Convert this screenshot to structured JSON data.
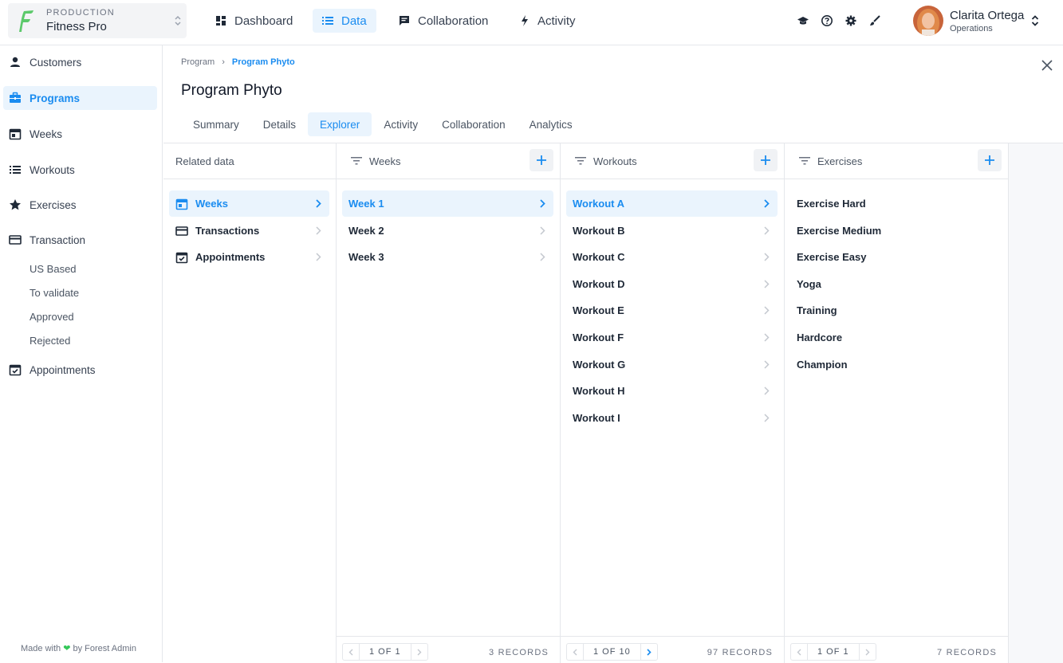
{
  "project": {
    "environment": "PRODUCTION",
    "name": "Fitness Pro"
  },
  "topnav": [
    {
      "label": "Dashboard",
      "icon": "dashboard-icon"
    },
    {
      "label": "Data",
      "icon": "list-icon",
      "active": true
    },
    {
      "label": "Collaboration",
      "icon": "chat-icon"
    },
    {
      "label": "Activity",
      "icon": "bolt-icon"
    }
  ],
  "user": {
    "name": "Clarita Ortega",
    "role": "Operations"
  },
  "sidebar": {
    "items": [
      {
        "label": "Customers",
        "icon": "person-icon"
      },
      {
        "label": "Programs",
        "icon": "briefcase-icon",
        "active": true
      },
      {
        "label": "Weeks",
        "icon": "calendar-icon"
      },
      {
        "label": "Workouts",
        "icon": "list-icon"
      },
      {
        "label": "Exercises",
        "icon": "star-icon"
      },
      {
        "label": "Transaction",
        "icon": "card-icon"
      }
    ],
    "sub_items": [
      "US Based",
      "To validate",
      "Approved",
      "Rejected"
    ],
    "last_item": {
      "label": "Appointments",
      "icon": "calendar-check-icon"
    },
    "footer": {
      "prefix": "Made with",
      "suffix": "by Forest Admin"
    }
  },
  "breadcrumb": {
    "parent": "Program",
    "current": "Program Phyto"
  },
  "page_title": "Program Phyto",
  "tabs": [
    "Summary",
    "Details",
    "Explorer",
    "Activity",
    "Collaboration",
    "Analytics"
  ],
  "active_tab": "Explorer",
  "explorer": {
    "related": {
      "header": "Related data",
      "items": [
        {
          "label": "Weeks",
          "icon": "calendar-icon",
          "active": true
        },
        {
          "label": "Transactions",
          "icon": "card-icon"
        },
        {
          "label": "Appointments",
          "icon": "calendar-check-icon"
        }
      ]
    },
    "weeks": {
      "header": "Weeks",
      "items": [
        "Week 1",
        "Week 2",
        "Week 3"
      ],
      "active": "Week 1",
      "pager": "1 OF 1",
      "records": "3 RECORDS"
    },
    "workouts": {
      "header": "Workouts",
      "items": [
        "Workout A",
        "Workout B",
        "Workout C",
        "Workout D",
        "Workout E",
        "Workout F",
        "Workout G",
        "Workout H",
        "Workout I"
      ],
      "active": "Workout A",
      "pager": "1 OF 10",
      "records": "97 RECORDS"
    },
    "exercises": {
      "header": "Exercises",
      "items": [
        "Exercise Hard",
        "Exercise Medium",
        "Exercise Easy",
        "Yoga",
        "Training",
        "Hardcore",
        "Champion"
      ],
      "pager": "1 OF 1",
      "records": "7 RECORDS"
    }
  },
  "colors": {
    "accent": "#1a8cf0",
    "active_bg": "#eaf4fd",
    "logo": "#5cc96b"
  }
}
